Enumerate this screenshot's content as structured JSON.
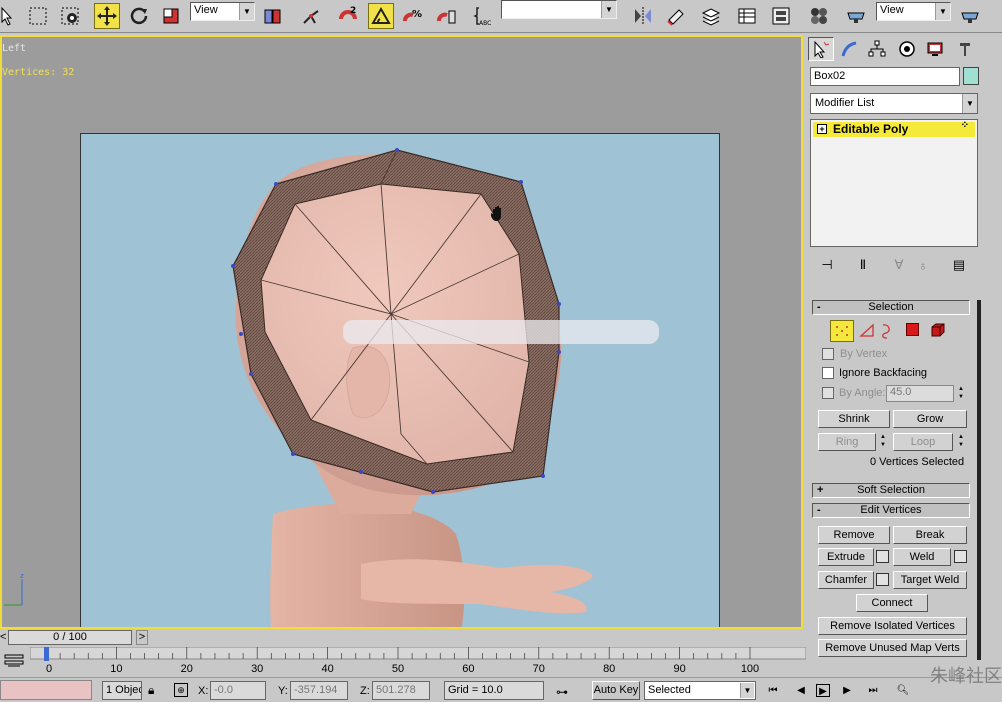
{
  "toolbar": {
    "view_dropdown_1": "View",
    "view_dropdown_2": "View",
    "selection_set_value": ""
  },
  "viewport": {
    "name": "Left",
    "stats": "Vertices: 32"
  },
  "command_panel": {
    "object_name": "Box02",
    "object_color": "#9fe0d2",
    "modifier_list": "Modifier List",
    "stack_item": "Editable Poly",
    "selection": {
      "title": "Selection",
      "by_vertex": "By Vertex",
      "ignore_backfacing": "Ignore Backfacing",
      "by_angle": "By Angle:",
      "angle_value": "45.0",
      "shrink": "Shrink",
      "grow": "Grow",
      "ring": "Ring",
      "loop": "Loop",
      "status": "0 Vertices Selected"
    },
    "soft_selection": {
      "title": "Soft Selection"
    },
    "edit_vertices": {
      "title": "Edit Vertices",
      "remove": "Remove",
      "break": "Break",
      "extrude": "Extrude",
      "weld": "Weld",
      "chamfer": "Chamfer",
      "target_weld": "Target Weld",
      "connect": "Connect",
      "remove_isolated": "Remove Isolated Vertices",
      "remove_unused": "Remove Unused Map Verts"
    }
  },
  "timeline": {
    "frame_display": "0 / 100",
    "ticks": [
      "0",
      "10",
      "20",
      "30",
      "40",
      "50",
      "60",
      "70",
      "80",
      "90",
      "100"
    ]
  },
  "status_bar": {
    "objects": "1 Objec",
    "x_label": "X:",
    "x_value": "-0.0",
    "y_label": "Y:",
    "y_value": "-357.194",
    "z_label": "Z:",
    "z_value": "501.278",
    "grid": "Grid = 10.0",
    "auto_key": "Auto Key",
    "key_filter": "Selected"
  },
  "watermark": "朱峰社区",
  "colors": {
    "active_yellow": "#f2e24a",
    "viewport_border": "#f0dd3c",
    "safe_frame_bg": "#9fc3d4",
    "skin": "#e8b8a8"
  }
}
